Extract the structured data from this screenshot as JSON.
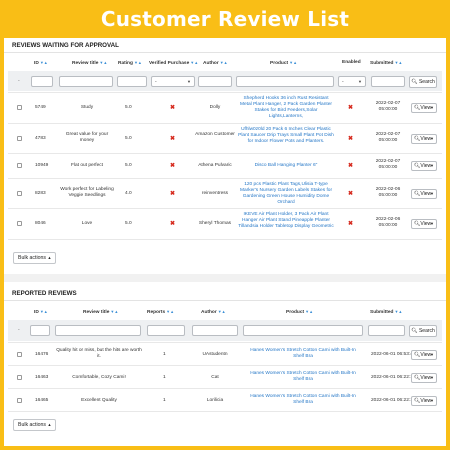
{
  "banner": {
    "title": "Customer Review List"
  },
  "colors": {
    "brand": "#f9be16",
    "link": "#2577c7",
    "cross": "#d62a1e",
    "sort": "#3b8fd6"
  },
  "pending": {
    "title": "REVIEWS WAITING FOR APPROVAL",
    "columns": {
      "id": "ID",
      "title": "Review title",
      "rating": "Rating",
      "verified": "Verified Purchase",
      "author": "Author",
      "product": "Product",
      "enabled": "Enabled",
      "submitted": "Submitted"
    },
    "filters": {
      "dash": "-",
      "verified_value": "-",
      "enabled_value": "-",
      "search": "Search"
    },
    "rows": [
      {
        "id": "5749",
        "title": "Study",
        "rating": "5.0",
        "author": "Dolly",
        "product": "Shepherd Hooks 36 inch Rust Resistant Metal Plant Hanger, 2 Pack Garden Planter Stakes for Bird Feeders,Solar Lights,Lanterns,",
        "submitted": "2022-02-07 05:00:00",
        "view": "View"
      },
      {
        "id": "4783",
        "title": "Great value for your money",
        "rating": "5.0",
        "author": "Amazon Customer",
        "product": "Ufhlw0z0ld 20 Pack 6 Inches Clear Plastic Plant Saucer Drip Trays Small Plant Pot Dish for Indoor Flower Pots and Planters.",
        "submitted": "2022-02-07 05:00:00",
        "view": "View"
      },
      {
        "id": "10949",
        "title": "Flat out perfect",
        "rating": "5.0",
        "author": "Athena Pulvaric",
        "product": "Disco Ball Hanging Planter 6\"",
        "submitted": "2022-02-07 05:00:00",
        "view": "View"
      },
      {
        "id": "8283",
        "title": "Work perfect for Labeling Veggie Seedlings",
        "rating": "4.0",
        "author": "reinventress",
        "product": "120 pcs Plastic Plant Tags,Ulisia T-type Marker's Nursery Garden Labels Stakes for Gardening Green House Humidity Dome Orchard",
        "submitted": "2022-02-06 05:00:00",
        "view": "View"
      },
      {
        "id": "8046",
        "title": "Love",
        "rating": "5.0",
        "author": "Sheryl Thomas",
        "product": "IKEVE Air Plant Holder, 3 Pack Air Plant Hanger Air Plant Stand Pineapple Planter Tillandsia Holder Tabletop Display Geometric",
        "submitted": "2022-02-06 05:00:00",
        "view": "View"
      }
    ],
    "bulk": "Bulk actions"
  },
  "reported": {
    "title": "REPORTED REVIEWS",
    "columns": {
      "id": "ID",
      "title": "Review title",
      "reports": "Reports",
      "author": "Author",
      "product": "Product",
      "submitted": "Submitted"
    },
    "filters": {
      "dash": "-",
      "search": "Search"
    },
    "rows": [
      {
        "id": "16476",
        "title": "Quality hit or miss, but the hits are worth it.",
        "reports": "1",
        "author": "UAstudentn",
        "product": "Hanes Women's Stretch Cotton Cami with Built-In Shelf Bra",
        "submitted": "2022-06-01 06:53:47",
        "view": "View"
      },
      {
        "id": "16463",
        "title": "Comfortable, Cozy Cami!",
        "reports": "1",
        "author": "Cat",
        "product": "Hanes Women's Stretch Cotton Cami with Built-In Shelf Bra",
        "submitted": "2022-06-01 06:22:10",
        "view": "View"
      },
      {
        "id": "16465",
        "title": "Excellent Quality",
        "reports": "1",
        "author": "Lorilicia",
        "product": "Hanes Women's Stretch Cotton Cami with Built-In Shelf Bra",
        "submitted": "2022-06-01 06:22:10",
        "view": "View"
      }
    ],
    "bulk": "Bulk actions"
  }
}
